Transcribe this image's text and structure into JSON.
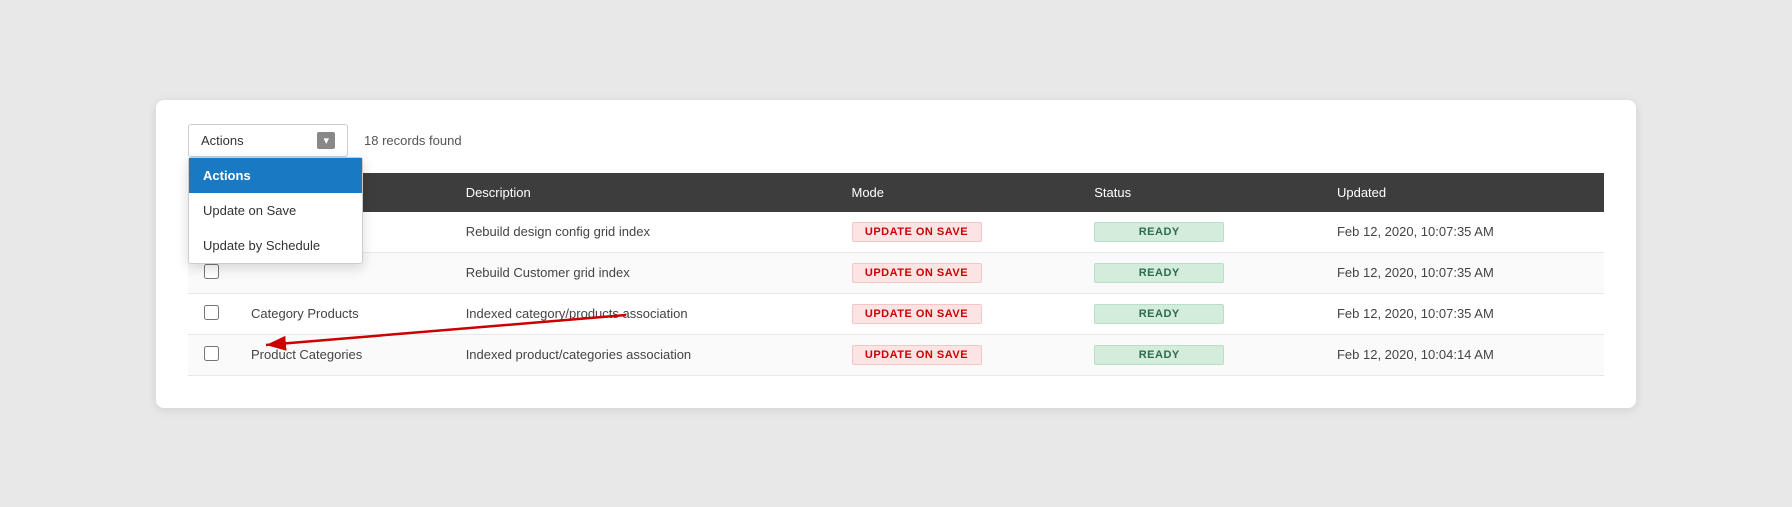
{
  "toolbar": {
    "actions_label": "Actions",
    "records_count": "18 records found",
    "dropdown": {
      "items": [
        {
          "id": "actions-header",
          "label": "Actions",
          "active": true
        },
        {
          "id": "update-on-save",
          "label": "Update on Save",
          "active": false
        },
        {
          "id": "update-by-schedule",
          "label": "Update by Schedule",
          "active": false
        }
      ]
    }
  },
  "table": {
    "columns": [
      {
        "id": "checkbox",
        "label": ""
      },
      {
        "id": "name",
        "label": ""
      },
      {
        "id": "description",
        "label": "Description"
      },
      {
        "id": "mode",
        "label": "Mode"
      },
      {
        "id": "status",
        "label": "Status"
      },
      {
        "id": "updated",
        "label": "Updated"
      }
    ],
    "rows": [
      {
        "checkbox": false,
        "name": "",
        "description": "Rebuild design config grid index",
        "mode": "UPDATE ON SAVE",
        "mode_style": "pink",
        "status": "READY",
        "status_style": "green",
        "updated": "Feb 12, 2020, 10:07:35 AM"
      },
      {
        "checkbox": false,
        "name": "",
        "description": "Rebuild Customer grid index",
        "mode": "UPDATE ON SAVE",
        "mode_style": "pink",
        "status": "READY",
        "status_style": "green",
        "updated": "Feb 12, 2020, 10:07:35 AM"
      },
      {
        "checkbox": false,
        "name": "Category Products",
        "description": "Indexed category/products association",
        "mode": "UPDATE ON SAVE",
        "mode_style": "pink",
        "status": "READY",
        "status_style": "green",
        "updated": "Feb 12, 2020, 10:07:35 AM"
      },
      {
        "checkbox": false,
        "name": "Product Categories",
        "description": "Indexed product/categories association",
        "mode": "UPDATE ON SAVE",
        "mode_style": "pink",
        "status": "READY",
        "status_style": "green",
        "updated": "Feb 12, 2020, 10:04:14 AM"
      }
    ]
  }
}
